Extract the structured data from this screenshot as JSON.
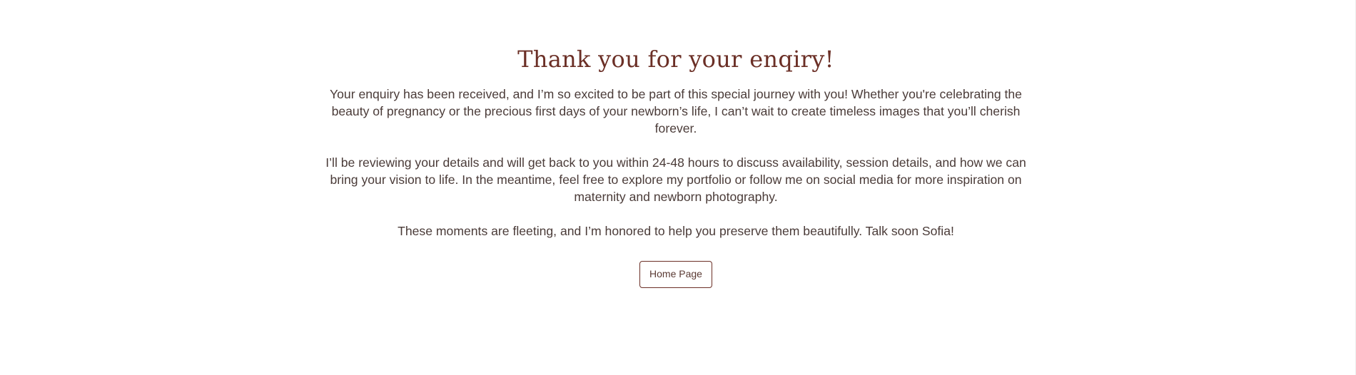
{
  "heading": "Thank you for your enqiry!",
  "paragraphs": [
    "Your enquiry has been received, and I’m so excited to be part of this special journey with you! Whether you're celebrating the beauty of pregnancy or the precious first days of your newborn’s life, I can’t wait to create timeless images that you’ll cherish forever.",
    "I’ll be reviewing your details and will get back to you within 24-48 hours to discuss availability, session details, and how we can bring your vision to life. In the meantime, feel free to explore my portfolio or follow me on social media for more inspiration on maternity and newborn photography.",
    "These moments are fleeting, and I’m honored to help you preserve them beautifully. Talk soon Sofia!"
  ],
  "home_button_label": "Home Page",
  "colors": {
    "accent": "#6b2f26",
    "body_text": "#4a3b38",
    "background": "#ffffff"
  }
}
